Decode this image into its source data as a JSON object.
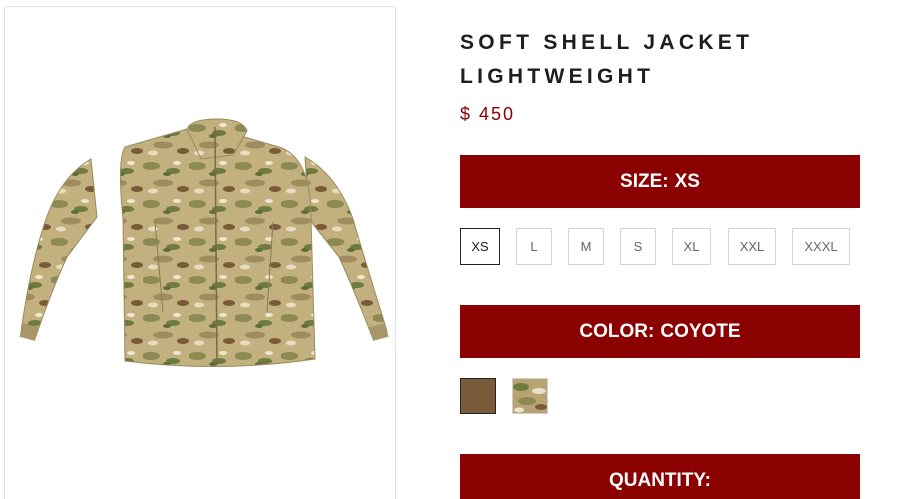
{
  "product": {
    "title": "SOFT SHELL JACKET LIGHTWEIGHT",
    "price": "$ 450"
  },
  "size": {
    "label": "SIZE:",
    "selected": "XS",
    "options": [
      "XS",
      "L",
      "M",
      "S",
      "XL",
      "XXL",
      "XXXL"
    ]
  },
  "color": {
    "label": "COLOR:",
    "selected": "COYOTE",
    "swatches": [
      {
        "name": "coyote",
        "color": "#7a5a38"
      },
      {
        "name": "multicam",
        "color": "#b8a473"
      }
    ]
  },
  "quantity": {
    "label": "QUANTITY:"
  },
  "colors": {
    "accent": "#8b0000",
    "title": "#1e1e1e"
  }
}
